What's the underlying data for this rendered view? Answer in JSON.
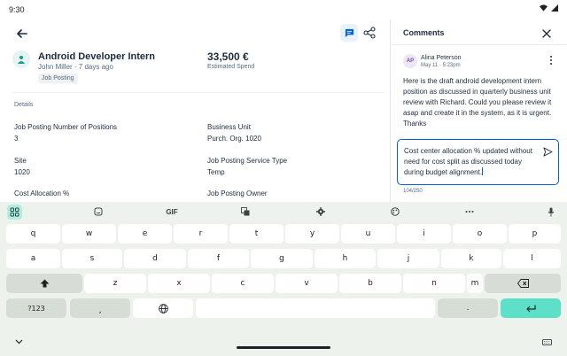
{
  "status": {
    "time": "9:30"
  },
  "header": {
    "back_icon": "arrow-back-icon",
    "chat_icon": "comment-icon",
    "share_icon": "share-icon"
  },
  "job": {
    "title": "Android Developer Intern",
    "subtitle": "John Miller · 7 days ago",
    "tag": "Job Posting",
    "amount": "33,500 €",
    "amount_label": "Estimated Spend"
  },
  "details": {
    "section_label": "Details",
    "fields": [
      {
        "label": "Job Posting Number of Positions",
        "value": "3"
      },
      {
        "label": "Business Unit",
        "value": "Purch. Org. 1020"
      },
      {
        "label": "Site",
        "value": "1020"
      },
      {
        "label": "Job Posting Service Type",
        "value": "Temp"
      },
      {
        "label": "Cost Allocation %",
        "value": ""
      },
      {
        "label": "Job Posting Owner",
        "value": ""
      }
    ]
  },
  "comments": {
    "title": "Comments",
    "items": [
      {
        "initials": "AP",
        "author": "Alina Peterson",
        "time": "May 11 · 5:23pm",
        "text": "Here is the draft android development intern position as discussed in quarterly business unit review with Richard. Could you please review it asap and create it in the system, as it is urgent. Thanks"
      }
    ],
    "reply_value": "Cost center allocation % updated without need for cost split as discussed today during budget alignment.",
    "char_count": "104/250"
  },
  "keyboard": {
    "toolbar": {
      "gif": "GIF"
    },
    "row1": [
      "q",
      "w",
      "e",
      "r",
      "t",
      "y",
      "u",
      "i",
      "o",
      "p"
    ],
    "row2": [
      "a",
      "s",
      "d",
      "f",
      "g",
      "h",
      "j",
      "k",
      "l"
    ],
    "row3": [
      "z",
      "x",
      "c",
      "v",
      "b",
      "n",
      "m"
    ],
    "symbols_key": "?123",
    "comma_key": ",",
    "period_key": "."
  },
  "colors": {
    "accent": "#0064d9",
    "keyboard_accent": "#5ee0c8",
    "keyboard_bg": "#eef2ed"
  }
}
